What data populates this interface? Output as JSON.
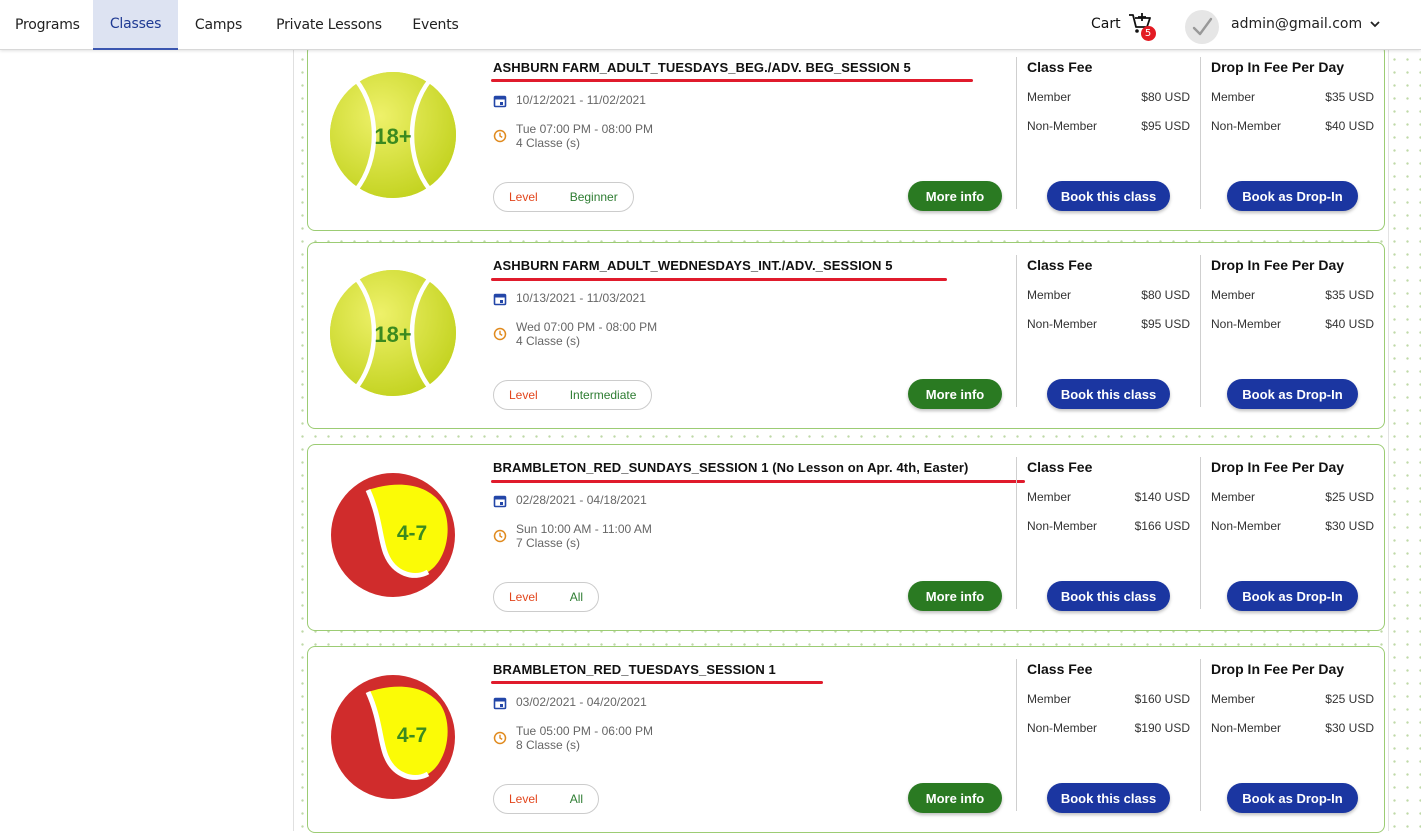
{
  "nav": {
    "items": [
      "Programs",
      "Classes",
      "Camps",
      "Private Lessons",
      "Events"
    ],
    "active": "Classes"
  },
  "cart": {
    "label": "Cart",
    "count": "5"
  },
  "user": {
    "email": "admin@gmail.com"
  },
  "labels": {
    "class_fee": "Class Fee",
    "drop_fee": "Drop In Fee Per Day",
    "member": "Member",
    "non_member": "Non-Member",
    "level": "Level",
    "more_info": "More info",
    "book_class": "Book this class",
    "book_drop": "Book as Drop-In"
  },
  "colors": {
    "accent_green": "#2a7a22",
    "accent_blue": "#1b36a1",
    "underline_red": "#e01b2c",
    "card_border": "#9ccc74"
  },
  "classes": [
    {
      "title": "ASHBURN FARM_ADULT_TUESDAYS_BEG./ADV. BEG_SESSION 5",
      "ball": "18+",
      "ball_icon": "tennis-ball-adult-icon",
      "dates": "10/12/2021 - 11/02/2021",
      "time": "Tue 07:00 PM - 08:00 PM",
      "count": "4 Classe (s)",
      "level": "Beginner",
      "fee_member": "$80 USD",
      "fee_nonmember": "$95 USD",
      "drop_member": "$35 USD",
      "drop_nonmember": "$40 USD"
    },
    {
      "title": "ASHBURN FARM_ADULT_WEDNESDAYS_INT./ADV._SESSION 5",
      "ball": "18+",
      "ball_icon": "tennis-ball-adult-icon",
      "dates": "10/13/2021 - 11/03/2021",
      "time": "Wed 07:00 PM - 08:00 PM",
      "count": "4 Classe (s)",
      "level": "Intermediate",
      "fee_member": "$80 USD",
      "fee_nonmember": "$95 USD",
      "drop_member": "$35 USD",
      "drop_nonmember": "$40 USD"
    },
    {
      "title": "BRAMBLETON_RED_SUNDAYS_SESSION 1 (No Lesson on Apr. 4th, Easter)",
      "ball": "4-7",
      "ball_icon": "tennis-ball-red-icon",
      "dates": "02/28/2021 - 04/18/2021",
      "time": "Sun 10:00 AM - 11:00 AM",
      "count": "7 Classe (s)",
      "level": "All",
      "fee_member": "$140 USD",
      "fee_nonmember": "$166 USD",
      "drop_member": "$25 USD",
      "drop_nonmember": "$30 USD"
    },
    {
      "title": "BRAMBLETON_RED_TUESDAYS_SESSION 1",
      "ball": "4-7",
      "ball_icon": "tennis-ball-red-icon",
      "dates": "03/02/2021 - 04/20/2021",
      "time": "Tue 05:00 PM - 06:00 PM",
      "count": "8 Classe (s)",
      "level": "All",
      "fee_member": "$160 USD",
      "fee_nonmember": "$190 USD",
      "drop_member": "$25 USD",
      "drop_nonmember": "$30 USD"
    }
  ]
}
